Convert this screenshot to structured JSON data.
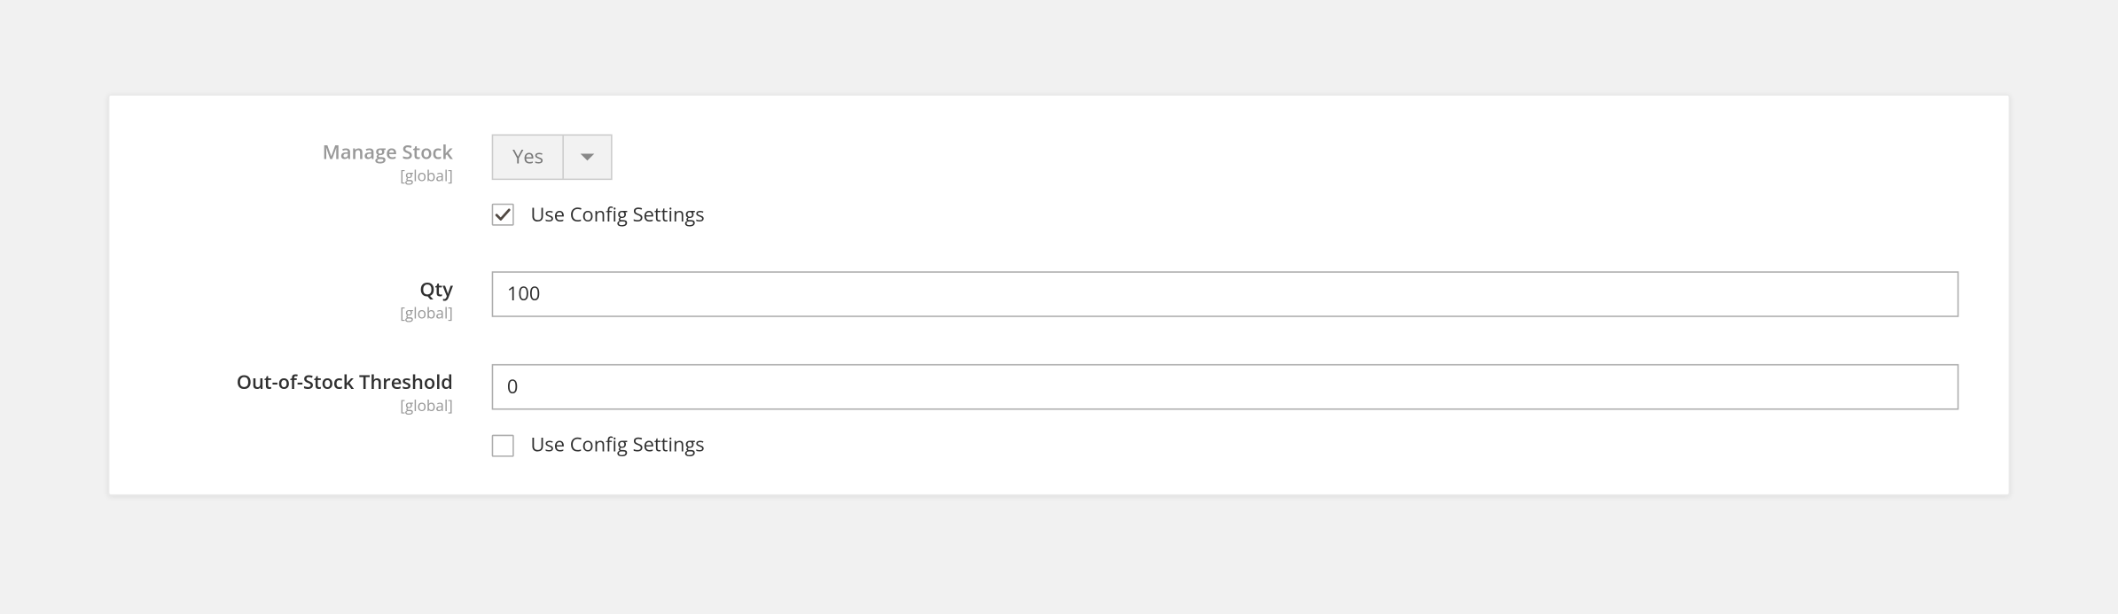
{
  "fields": {
    "manage_stock": {
      "label": "Manage Stock",
      "scope": "[global]",
      "value": "Yes",
      "use_config_label": "Use Config Settings"
    },
    "qty": {
      "label": "Qty",
      "scope": "[global]",
      "value": "100"
    },
    "out_of_stock_threshold": {
      "label": "Out-of-Stock Threshold",
      "scope": "[global]",
      "value": "0",
      "use_config_label": "Use Config Settings"
    }
  }
}
